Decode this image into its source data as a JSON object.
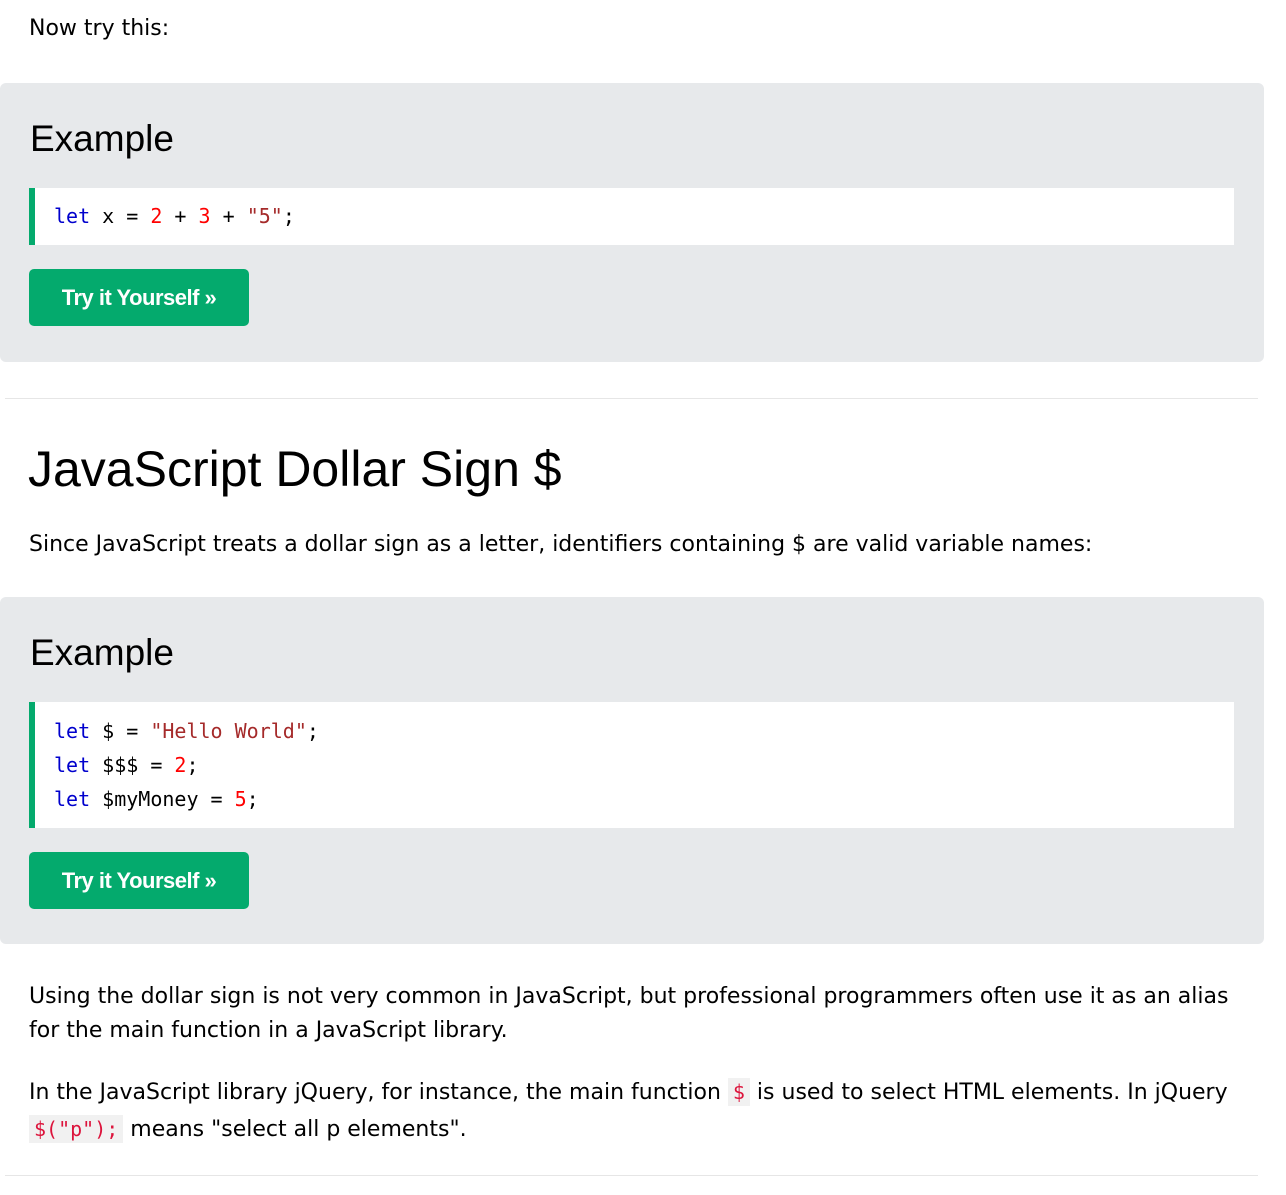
{
  "intro": {
    "text": "Now try this:"
  },
  "example1": {
    "heading": "Example",
    "code": {
      "line1": {
        "kw": "let",
        "pre": " x = ",
        "n1": "2",
        "mid1": " + ",
        "n2": "3",
        "mid2": " + ",
        "s1": "\"5\"",
        "end": ";"
      }
    },
    "button_label": "Try it Yourself »"
  },
  "section": {
    "title": "JavaScript Dollar Sign $",
    "intro_text": "Since JavaScript treats a dollar sign as a letter, identifiers containing $ are valid variable names:"
  },
  "example2": {
    "heading": "Example",
    "code": {
      "line1": {
        "kw": "let",
        "name": " $ = ",
        "val": "\"Hello World\"",
        "end": ";"
      },
      "line2": {
        "kw": "let",
        "name": " $$$ = ",
        "val": "2",
        "end": ";"
      },
      "line3": {
        "kw": "let",
        "name": " $myMoney = ",
        "val": "5",
        "end": ";"
      }
    },
    "button_label": "Try it Yourself »"
  },
  "paragraphs": {
    "p2": "Using the dollar sign is not very common in JavaScript, but professional programmers often use it as an alias for the main function in a JavaScript library.",
    "p3_part1": "In the JavaScript library jQuery, for instance, the main function ",
    "p3_code1": "$",
    "p3_part2": " is used to select HTML elements. In jQuery ",
    "p3_code2": "$(\"p\");",
    "p3_part3": " means \"select all p elements\"."
  },
  "colors": {
    "accent": "#04aa6d",
    "example_bg": "#e7e9eb",
    "keyword": "#0000cd",
    "number": "#ff0000",
    "string": "#a52a2a",
    "inline_code": "#dc143c"
  }
}
